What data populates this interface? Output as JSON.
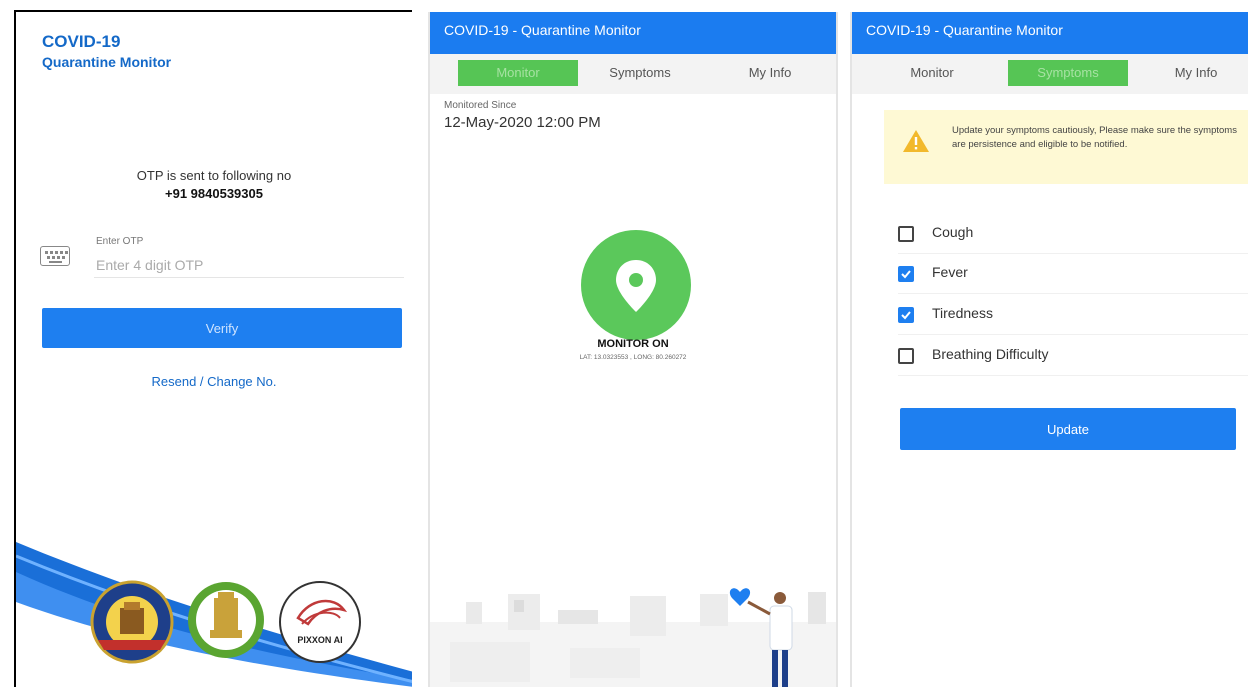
{
  "login": {
    "title": "COVID-19",
    "subtitle": "Quarantine Monitor",
    "otp_message": "OTP is sent to following no",
    "phone": "+91 9840539305",
    "otp_label": "Enter OTP",
    "otp_placeholder": "Enter 4 digit OTP",
    "verify_label": "Verify",
    "resend_label": "Resend / Change No.",
    "logos": {
      "police_seal_text": "TAMIL NADU POLICE · TRUTH ALONE TRIUMPHS",
      "gov_emblem_text": "Tamil Nadu Government",
      "pixxon_text": "PIXXON AI"
    }
  },
  "monitor": {
    "app_title": "COVID-19 - Quarantine Monitor",
    "tabs": [
      "Monitor",
      "Symptoms",
      "My Info"
    ],
    "active_tab": 0,
    "monitored_since_label": "Monitored Since",
    "monitored_since_value": "12-May-2020 12:00 PM",
    "status": "MONITOR ON",
    "coords": "LAT: 13.0323553 , LONG: 80.260272",
    "icon": "location-pin-icon"
  },
  "symptoms": {
    "app_title": "COVID-19 - Quarantine Monitor",
    "tabs": [
      "Monitor",
      "Symptoms",
      "My Info"
    ],
    "active_tab": 1,
    "alert": "Update your symptoms cautiously, Please make sure the symptoms are persistence and eligible to be notified.",
    "items": [
      {
        "label": "Cough",
        "checked": false
      },
      {
        "label": "Fever",
        "checked": true
      },
      {
        "label": "Tiredness",
        "checked": true
      },
      {
        "label": "Breathing Difficulty",
        "checked": false
      }
    ],
    "update_label": "Update"
  },
  "colors": {
    "primary": "#1b7cf0",
    "title_blue": "#1469c8",
    "green": "#5bc85b",
    "alert_bg": "#fef9d4"
  }
}
